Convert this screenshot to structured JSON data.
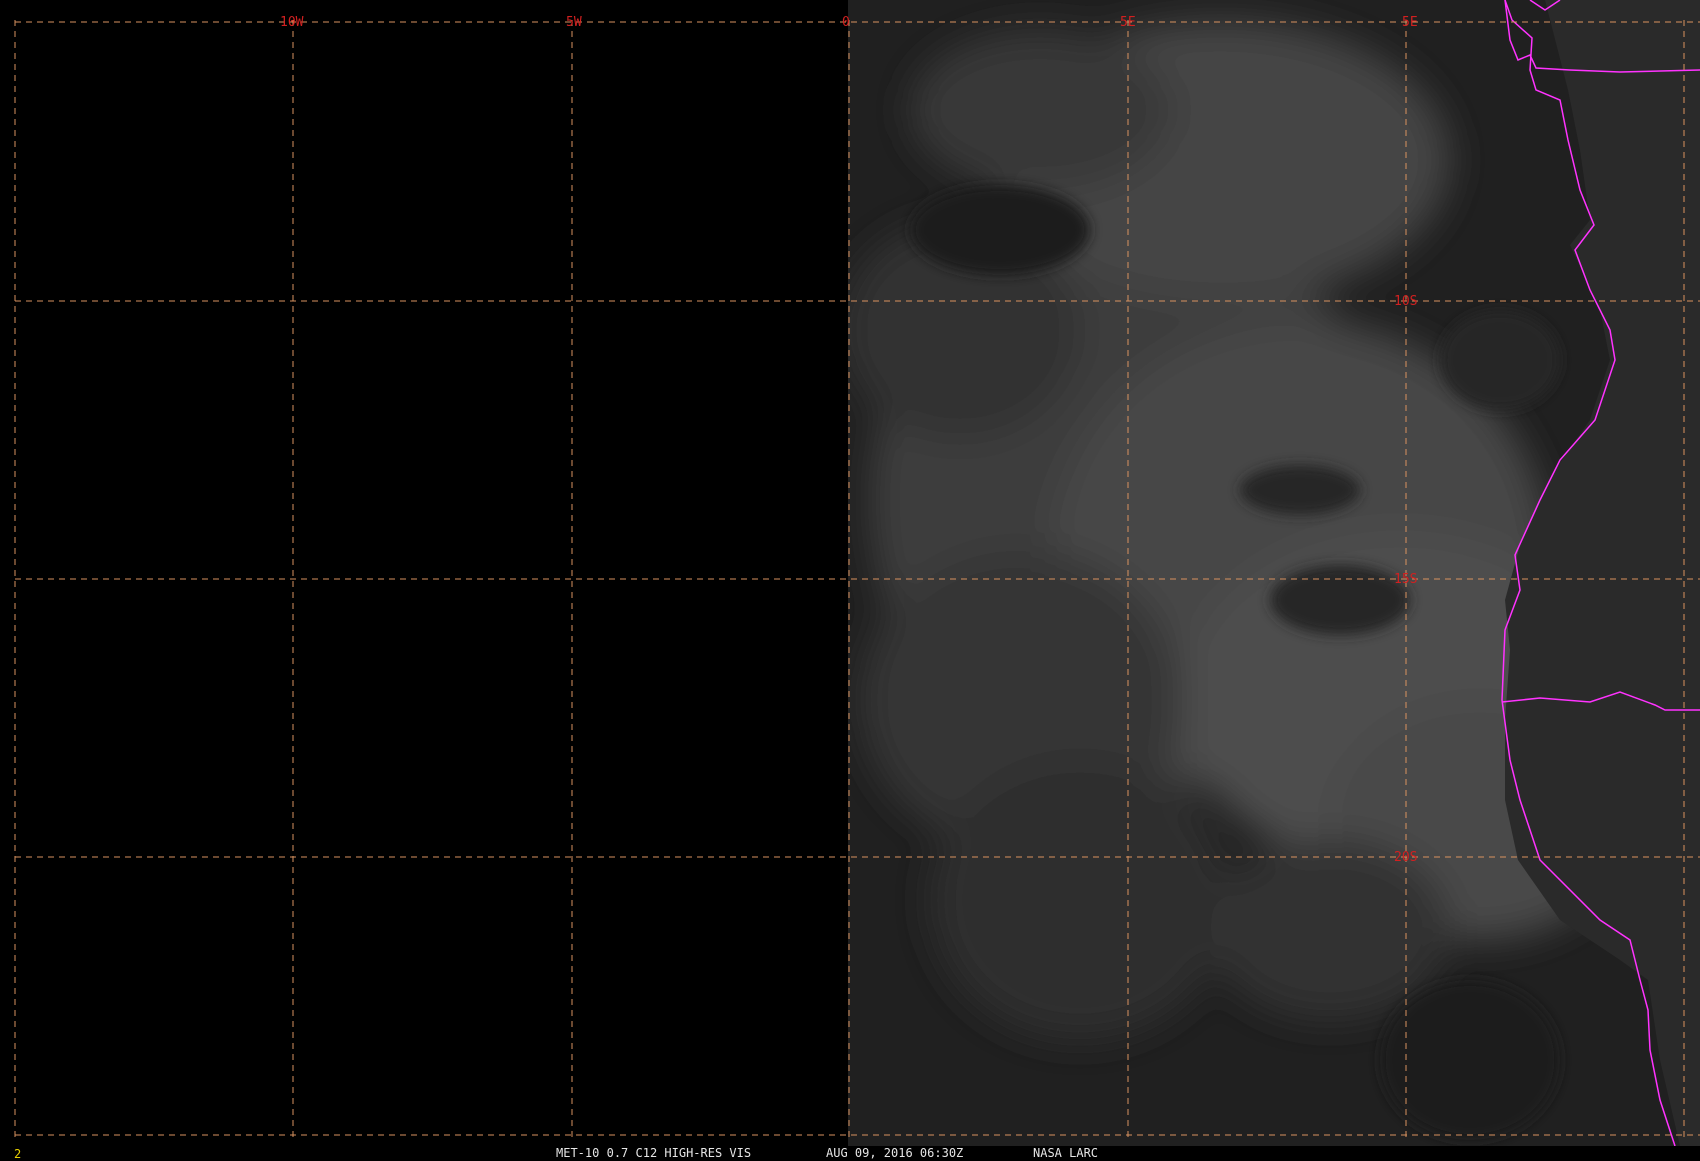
{
  "image": {
    "satellite": "MET-10",
    "channel": "0.7 C12 HIGH-RES VIS",
    "datetime": "AUG 09, 2016 06:30Z",
    "credit": "NASA LARC",
    "frame_number": "2"
  },
  "grid": {
    "longitude_labels": [
      "10W",
      "5W",
      "0",
      "5E",
      "5E"
    ],
    "latitude_labels": [
      "10S",
      "15S",
      "20S"
    ]
  },
  "colors": {
    "grid": "#d9925f",
    "label": "#d22020",
    "border": "#ff33ff",
    "status_text": "#e6e6e6",
    "frame_number": "#e8d000"
  }
}
